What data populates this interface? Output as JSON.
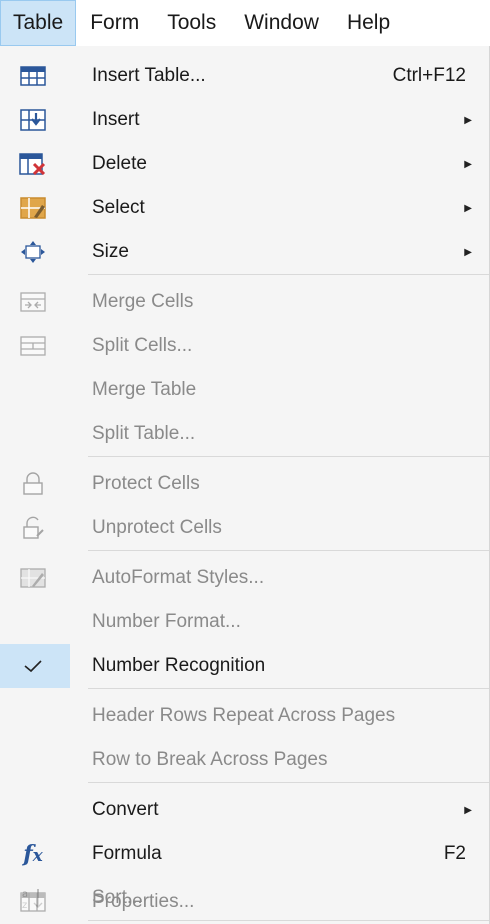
{
  "menubar": {
    "items": [
      "Table",
      "Form",
      "Tools",
      "Window",
      "Help"
    ]
  },
  "menu": {
    "insert_table": {
      "label": "Insert Table...",
      "shortcut": "Ctrl+F12"
    },
    "insert": {
      "label": "Insert"
    },
    "delete": {
      "label": "Delete"
    },
    "select": {
      "label": "Select"
    },
    "size": {
      "label": "Size"
    },
    "merge_cells": {
      "label": "Merge Cells"
    },
    "split_cells": {
      "label": "Split Cells..."
    },
    "merge_table": {
      "label": "Merge Table"
    },
    "split_table": {
      "label": "Split Table..."
    },
    "protect_cells": {
      "label": "Protect Cells"
    },
    "unprotect_cells": {
      "label": "Unprotect Cells"
    },
    "autoformat": {
      "label": "AutoFormat Styles..."
    },
    "number_format": {
      "label": "Number Format..."
    },
    "number_recognition": {
      "label": "Number Recognition",
      "checked": true
    },
    "header_rows": {
      "label": "Header Rows Repeat Across Pages"
    },
    "row_break": {
      "label": "Row to Break Across Pages"
    },
    "convert": {
      "label": "Convert"
    },
    "formula": {
      "label": "Formula",
      "shortcut": "F2"
    },
    "sort": {
      "label": "Sort..."
    },
    "properties": {
      "label": "Properties..."
    }
  },
  "colors": {
    "highlight": "#cce4f7",
    "disabled_text": "#8a8a8a",
    "icon_blue": "#2b579a",
    "icon_red": "#d13438",
    "icon_orange": "#c98c2e"
  }
}
